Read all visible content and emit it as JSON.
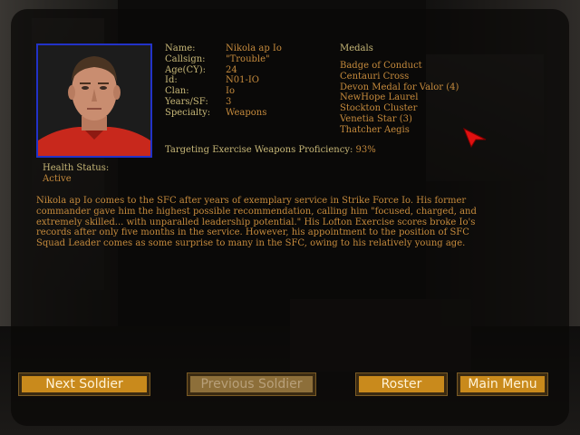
{
  "dossier": {
    "labels": [
      "Name:",
      "Callsign:",
      "Age(CY):",
      "Id:",
      "Clan:",
      "Years/SF:",
      "Specialty:"
    ],
    "values": [
      "Nikola ap Io",
      "\"Trouble\"",
      "24",
      "N01-IO",
      "Io",
      "3",
      "Weapons"
    ]
  },
  "medals": {
    "title": "Medals",
    "items": [
      "Badge of Conduct",
      "Centauri Cross",
      "Devon Medal for Valor (4)",
      "NewHope Laurel",
      "Stockton Cluster",
      "Venetia Star (3)",
      "Thatcher Aegis"
    ]
  },
  "proficiency": {
    "label": "Targeting Exercise Weapons Proficiency:",
    "value": "93%"
  },
  "health": {
    "label": "Health Status:",
    "value": "Active"
  },
  "bio": {
    "lines": [
      "Nikola ap Io comes to the SFC after years of exemplary service in Strike Force Io.  His former",
      "commander gave him the highest possible recommendation, calling him \"focused, charged, and",
      "extremely skilled... with unparalled leadership potential.\"  His Lofton Exercise scores broke Io's",
      "records after only five months in the service.  However, his appointment to the position of SFC",
      "Squad Leader comes as some surprise to many in the SFC, owing to his relatively young age."
    ]
  },
  "buttons": {
    "next": "Next Soldier",
    "previous": "Previous Soldier",
    "roster": "Roster",
    "main_menu": "Main Menu"
  },
  "colors": {
    "label": "#c8b878",
    "value": "#c58a3c",
    "button": "#c98a1c",
    "portrait_border": "#2232c8",
    "cursor": "#e01010"
  }
}
